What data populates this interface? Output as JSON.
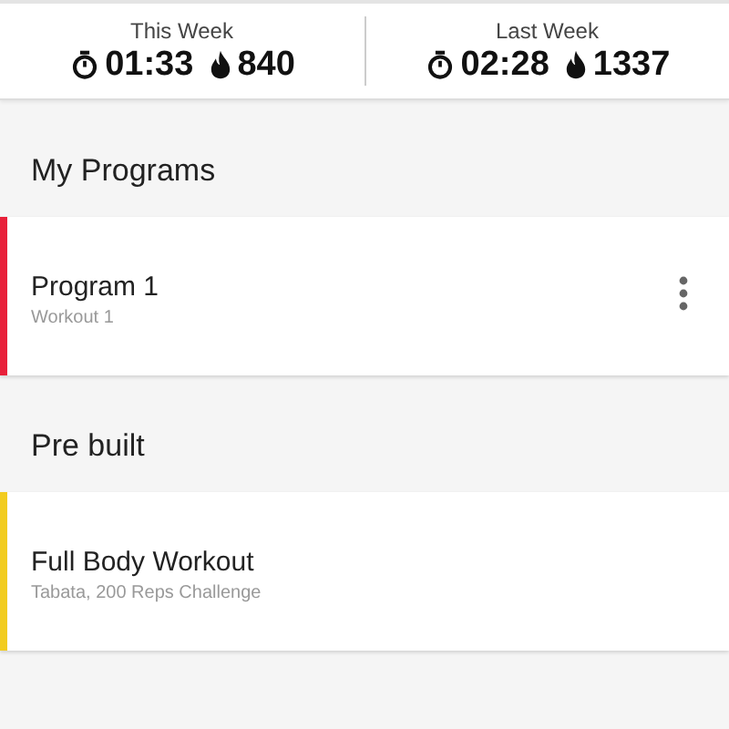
{
  "stats": [
    {
      "label": "This Week",
      "time": "01:33",
      "calories": "840"
    },
    {
      "label": "Last Week",
      "time": "02:28",
      "calories": "1337"
    }
  ],
  "sections": [
    {
      "title": "My Programs",
      "programs": [
        {
          "name": "Program 1",
          "subtitle": "Workout 1",
          "color": "#e8203a",
          "menu": true
        }
      ]
    },
    {
      "title": "Pre built",
      "programs": [
        {
          "name": "Full Body Workout",
          "subtitle": "Tabata, 200 Reps Challenge",
          "color": "#f2cc1f",
          "menu": false
        }
      ]
    }
  ]
}
